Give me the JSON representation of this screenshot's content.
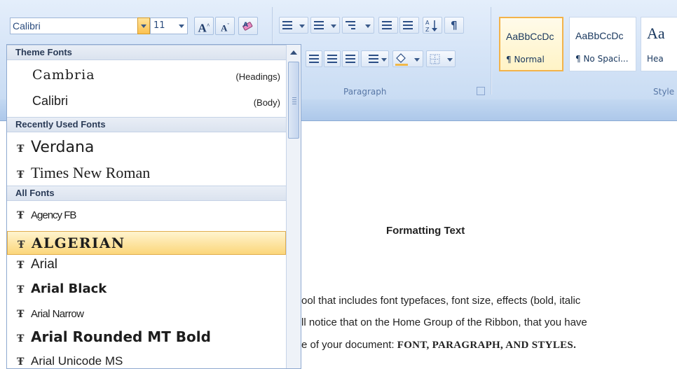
{
  "ribbon": {
    "font_name": "Calibri",
    "font_size": "11",
    "grow_font_label": "A",
    "shrink_font_label": "A",
    "paragraph_group_label": "Paragraph",
    "styles_group_label": "Style",
    "styles": [
      {
        "sample": "AaBbCcDc",
        "name": "¶ Normal",
        "selected": true
      },
      {
        "sample": "AaBbCcDc",
        "name": "¶ No Spaci...",
        "selected": false
      },
      {
        "sample": "Aa",
        "name": "Hea",
        "selected": false
      }
    ]
  },
  "font_dropdown": {
    "theme_header": "Theme Fonts",
    "theme_fonts": [
      {
        "name": "Cambria",
        "note": "(Headings)"
      },
      {
        "name": "Calibri",
        "note": "(Body)"
      }
    ],
    "recent_header": "Recently Used Fonts",
    "recent_fonts": [
      "Verdana",
      "Times New Roman"
    ],
    "all_header": "All Fonts",
    "all_fonts": [
      "Agency FB",
      "ALGERIAN",
      "Arial",
      "Arial Black",
      "Arial Narrow",
      "Arial Rounded MT Bold",
      "Arial Unicode MS"
    ],
    "highlighted": "ALGERIAN",
    "truetype_glyph": "Ŧ"
  },
  "document": {
    "title": "Formatting Text",
    "line1": "ool that includes font typefaces, font size, effects (bold, italic",
    "line2": "ll notice that on the Home Group of the Ribbon, that you have",
    "line3_prefix": "e of your document: ",
    "line3_bold": "FONT, PARAGRAPH, AND STYLES."
  }
}
